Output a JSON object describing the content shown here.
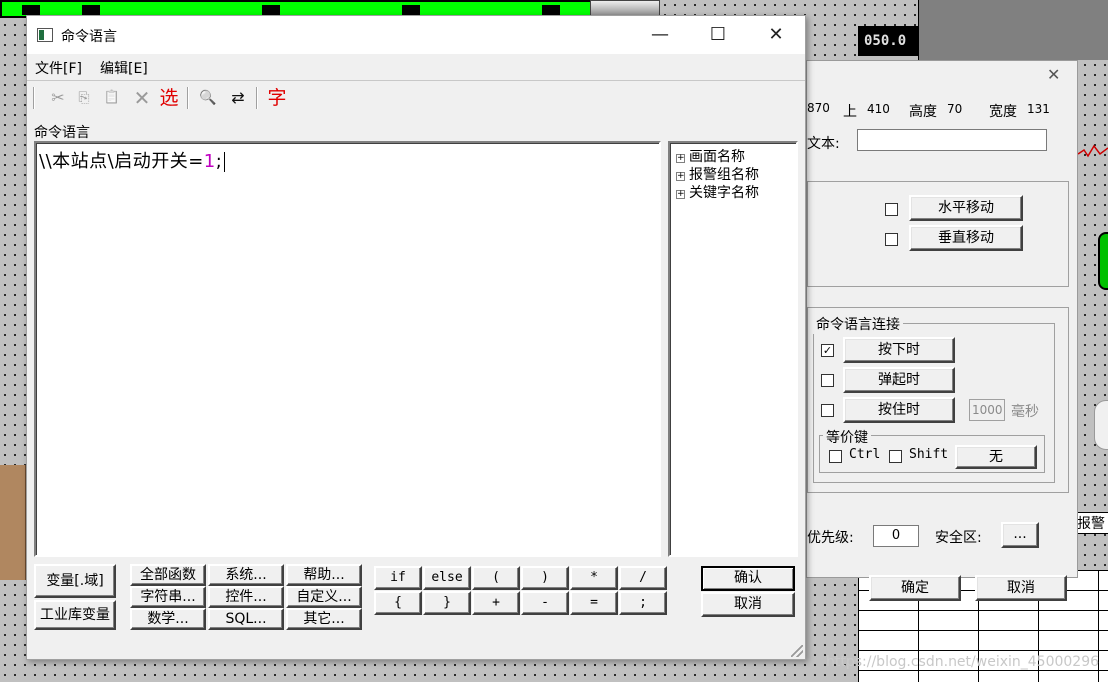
{
  "background": {
    "display_value": "050.0",
    "label_fragment": "报警",
    "watermark": "https://blog.csdn.net/weixin_45000296"
  },
  "properties_dialog": {
    "close_glyph": "✕",
    "left_value": "870",
    "top_label": "上",
    "top_value": "410",
    "height_label": "高度",
    "height_value": "70",
    "width_label": "宽度",
    "width_value": "131",
    "text_label": "文本:",
    "text_value": "",
    "horizontal_move": "水平移动",
    "vertical_move": "垂直移动",
    "cmd_link_title": "命令语言连接",
    "press_label": "按下时",
    "press_checked": true,
    "release_label": "弹起时",
    "hold_label": "按住时",
    "hold_ms_value": "1000",
    "ms_label": "毫秒",
    "hotkey_title": "等价键",
    "ctrl_label": "Ctrl",
    "shift_label": "Shift",
    "key_value": "无",
    "priority_label": "优先级:",
    "priority_value": "0",
    "security_label": "安全区:",
    "security_button": "...",
    "ok_label": "确定",
    "cancel_label": "取消"
  },
  "window": {
    "title": "命令语言",
    "minimize_glyph": "—",
    "maximize_glyph": "☐",
    "close_glyph": "✕",
    "menu": {
      "file": "文件[F]",
      "edit": "编辑[E]"
    },
    "toolbar": {
      "cut": "✂",
      "copy": "⎘",
      "paste": "📋",
      "delete": "✕",
      "select_label": "选",
      "find": "🔍",
      "replace": "⇄",
      "font_label": "字"
    },
    "section_label": "命令语言",
    "editor": {
      "code_text": "\\\\本站点\\启动开关=",
      "code_value": "1",
      "code_end": ";"
    },
    "tree": {
      "items": [
        "画面名称",
        "报警组名称",
        "关键字名称"
      ]
    },
    "buttons": {
      "variable": "变量[.域]",
      "industrial_var": "工业库变量",
      "all_functions": "全部函数",
      "system": "系统...",
      "help": "帮助...",
      "string": "字符串...",
      "control": "控件...",
      "custom": "自定义...",
      "math": "数学...",
      "sql": "SQL...",
      "other": "其它...",
      "ops_row1": [
        "if",
        "else",
        "(",
        ")",
        "*",
        "/"
      ],
      "ops_row2": [
        "{",
        "}",
        "+",
        "-",
        "=",
        ";"
      ],
      "confirm": "确认",
      "cancel": "取消"
    }
  }
}
